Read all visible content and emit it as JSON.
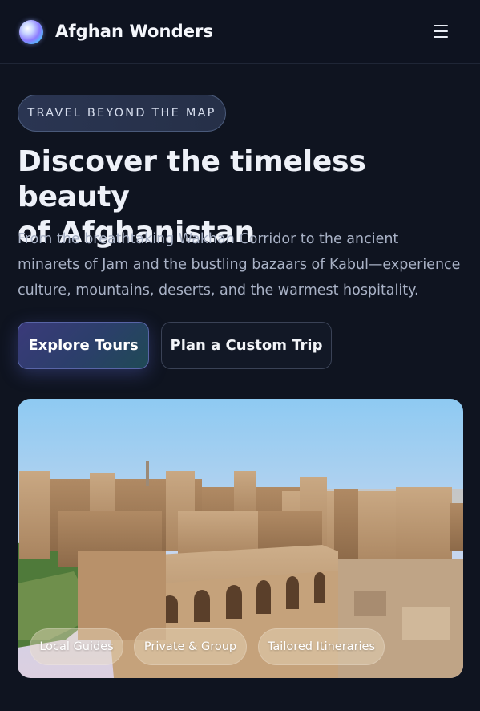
{
  "header": {
    "brand": "Afghan Wonders",
    "logo_icon": "gradient-orb-logo",
    "menu_icon": "hamburger-menu-icon"
  },
  "hero": {
    "eyebrow": "TRAVEL BEYOND THE MAP",
    "headline_line1": "Discover the timeless beauty",
    "headline_line2": "of Afghanistan",
    "lede_line1": "From the breathtaking Wakhan Corridor to the ancient",
    "lede_line2": "minarets of Jam and the bustling bazaars of Kabul—experience",
    "lede_line3": "culture, mountains, deserts, and the warmest hospitality.",
    "primary_cta": "Explore Tours",
    "secondary_cta": "Plan a Custom Trip",
    "image_subject": "herat-citadel-photo",
    "chips": [
      "Local Guides",
      "Private & Group",
      "Tailored Itineraries"
    ]
  },
  "colors": {
    "background": "#0f1420",
    "primary_button": "#2b3f6a",
    "text": "#eef1f7",
    "muted_text": "#a9b2c6"
  }
}
